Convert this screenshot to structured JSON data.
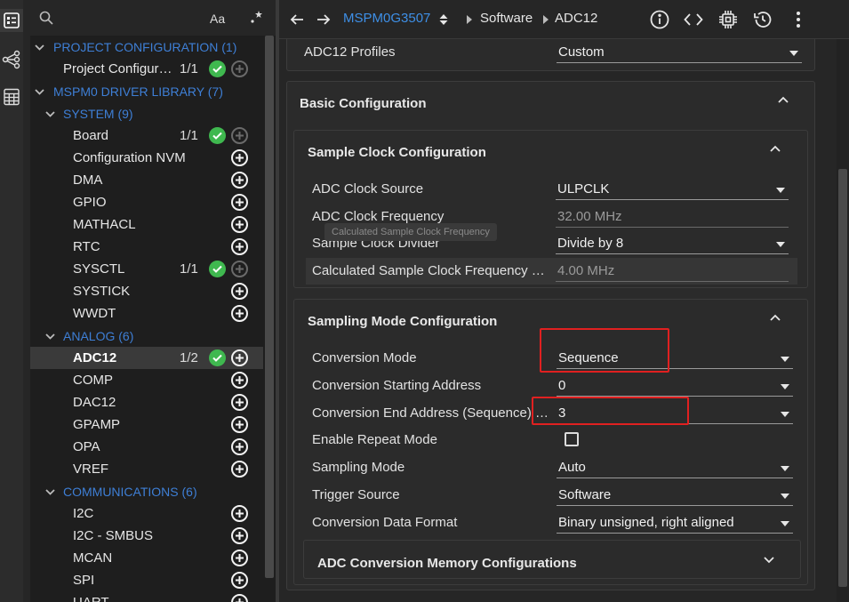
{
  "sidebar": {
    "items": [
      {
        "type": "cat",
        "level": 0,
        "label": "PROJECT CONFIGURATION (1)"
      },
      {
        "type": "leaf",
        "level": 1,
        "label": "Project Configur…",
        "count": "1/1",
        "status": "ok",
        "add": "dim"
      },
      {
        "type": "cat",
        "level": 0,
        "label": "MSPM0 DRIVER LIBRARY (7)"
      },
      {
        "type": "cat",
        "level": 1,
        "label": "SYSTEM (9)"
      },
      {
        "type": "leaf",
        "level": 2,
        "label": "Board",
        "count": "1/1",
        "status": "ok",
        "add": "dim"
      },
      {
        "type": "leaf",
        "level": 2,
        "label": "Configuration NVM",
        "add": "on"
      },
      {
        "type": "leaf",
        "level": 2,
        "label": "DMA",
        "add": "on"
      },
      {
        "type": "leaf",
        "level": 2,
        "label": "GPIO",
        "add": "on"
      },
      {
        "type": "leaf",
        "level": 2,
        "label": "MATHACL",
        "add": "on"
      },
      {
        "type": "leaf",
        "level": 2,
        "label": "RTC",
        "add": "on"
      },
      {
        "type": "leaf",
        "level": 2,
        "label": "SYSCTL",
        "count": "1/1",
        "status": "ok",
        "add": "dim"
      },
      {
        "type": "leaf",
        "level": 2,
        "label": "SYSTICK",
        "add": "on"
      },
      {
        "type": "leaf",
        "level": 2,
        "label": "WWDT",
        "add": "on"
      },
      {
        "type": "cat",
        "level": 1,
        "label": "ANALOG (6)"
      },
      {
        "type": "leaf",
        "level": 2,
        "label": "ADC12",
        "count": "1/2",
        "status": "ok",
        "add": "on",
        "selected": true
      },
      {
        "type": "leaf",
        "level": 2,
        "label": "COMP",
        "add": "on"
      },
      {
        "type": "leaf",
        "level": 2,
        "label": "DAC12",
        "add": "on"
      },
      {
        "type": "leaf",
        "level": 2,
        "label": "GPAMP",
        "add": "on"
      },
      {
        "type": "leaf",
        "level": 2,
        "label": "OPA",
        "add": "on"
      },
      {
        "type": "leaf",
        "level": 2,
        "label": "VREF",
        "add": "on"
      },
      {
        "type": "cat",
        "level": 1,
        "label": "COMMUNICATIONS (6)"
      },
      {
        "type": "leaf",
        "level": 2,
        "label": "I2C",
        "add": "on"
      },
      {
        "type": "leaf",
        "level": 2,
        "label": "I2C - SMBUS",
        "add": "on"
      },
      {
        "type": "leaf",
        "level": 2,
        "label": "MCAN",
        "add": "on"
      },
      {
        "type": "leaf",
        "level": 2,
        "label": "SPI",
        "add": "on"
      },
      {
        "type": "leaf",
        "level": 2,
        "label": "UART",
        "add": "on"
      }
    ],
    "header": {
      "case_label": "Aa"
    }
  },
  "topbar": {
    "device": "MSPM0G3507",
    "crumb1": "Software",
    "crumb2": "ADC12"
  },
  "profiles": {
    "label": "ADC12 Profiles",
    "value": "Custom"
  },
  "basic": {
    "title": "Basic Configuration",
    "sample_clock": {
      "title": "Sample Clock Configuration",
      "source_label": "ADC Clock Source",
      "source_value": "ULPCLK",
      "freq_label": "ADC Clock Frequency",
      "freq_value": "32.00 MHz",
      "divider_label": "Sample Clock Divider",
      "divider_value": "Divide by 8",
      "calc_label": "Calculated Sample Clock Frequency …",
      "calc_value": "4.00 MHz",
      "tooltip": "Calculated Sample Clock Frequency"
    },
    "sampling_mode": {
      "title": "Sampling Mode Configuration",
      "conv_mode_label": "Conversion Mode",
      "conv_mode_value": "Sequence",
      "start_addr_label": "Conversion Starting Address",
      "start_addr_value": "0",
      "end_addr_label": "Conversion End Address (Sequence) …",
      "end_addr_value": "3",
      "repeat_label": "Enable Repeat Mode",
      "sampling_label": "Sampling Mode",
      "sampling_value": "Auto",
      "trigger_label": "Trigger Source",
      "trigger_value": "Software",
      "format_label": "Conversion Data Format",
      "format_value": "Binary unsigned, right aligned",
      "memory_title": "ADC Conversion Memory Configurations"
    }
  },
  "colors": {
    "accent": "#3e7fd6",
    "ok": "#3fb84f",
    "highlight": "#e02020"
  }
}
